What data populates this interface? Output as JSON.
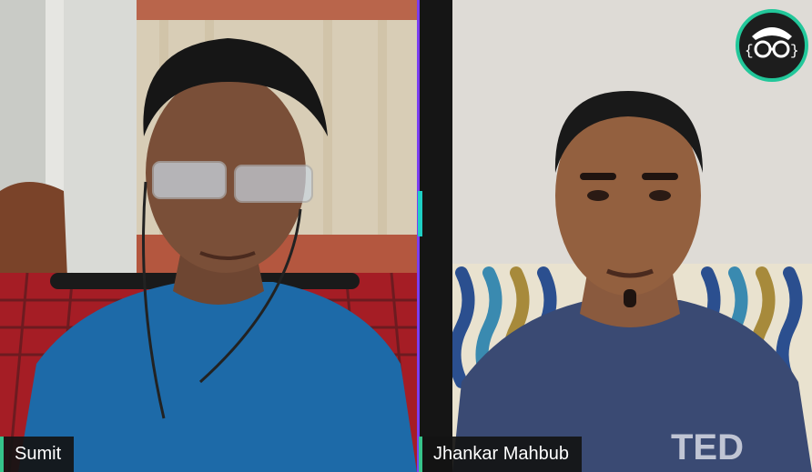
{
  "participants": [
    {
      "name": "Sumit"
    },
    {
      "name": "Jhankar Mahbub"
    }
  ],
  "colors": {
    "accent_divider": "#7b3df0",
    "accent_green": "#36c48a",
    "logo_ring": "#22c79a",
    "name_tag_bg": "#141414"
  },
  "logo": {
    "icon": "glasses-face-logo"
  }
}
